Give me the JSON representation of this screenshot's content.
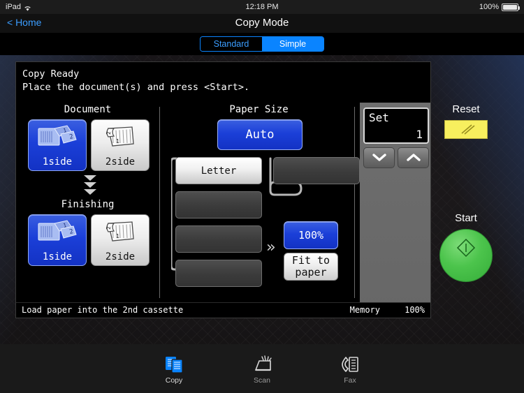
{
  "status_bar": {
    "device": "iPad",
    "wifi_icon": "wifi-icon",
    "time": "12:18 PM",
    "battery_percent": "100%",
    "battery_icon": "battery-full-icon"
  },
  "nav": {
    "back_label": "< Home",
    "title": "Copy Mode"
  },
  "mode_selector": {
    "options": [
      {
        "label": "Standard",
        "selected": false
      },
      {
        "label": "Simple",
        "selected": true
      }
    ],
    "accent_color": "#0a84ff"
  },
  "lcd": {
    "message_line1": "Copy Ready",
    "message_line2": "Place the document(s) and press <Start>.",
    "document": {
      "title": "Document",
      "buttons": [
        {
          "label": "1side",
          "selected": true,
          "icon": "sheets-1side-icon"
        },
        {
          "label": "2side",
          "selected": false,
          "icon": "sheet-2side-icon"
        }
      ]
    },
    "flow_icon": "triple-chevron-down-icon",
    "finishing": {
      "title": "Finishing",
      "buttons": [
        {
          "label": "1side",
          "selected": true,
          "icon": "sheets-1side-icon"
        },
        {
          "label": "2side",
          "selected": false,
          "icon": "sheet-2side-icon"
        }
      ]
    },
    "paper_size": {
      "title": "Paper Size",
      "auto_label": "Auto",
      "auto_selected": true,
      "trays_left": [
        {
          "label": "Letter",
          "selected": true
        },
        {
          "label": "",
          "selected": false
        },
        {
          "label": "",
          "selected": false
        },
        {
          "label": "",
          "selected": false
        }
      ],
      "trays_right": [
        {
          "label": "",
          "selected": false
        }
      ]
    },
    "zoom": {
      "arrow_icon": "double-chevron-right-icon",
      "buttons": [
        {
          "label": "100%",
          "selected": true
        },
        {
          "label": "Fit to\npaper",
          "selected": false
        }
      ]
    },
    "set": {
      "label": "Set",
      "value": "1",
      "down_icon": "chevron-down-icon",
      "up_icon": "chevron-up-icon"
    },
    "status": {
      "message": "Load paper into the 2nd cassette",
      "memory_label": "Memory",
      "memory_value": "100%"
    }
  },
  "hard_keys": {
    "reset_label": "Reset",
    "reset_icon": "reset-key-icon",
    "reset_color": "#f7ef5e",
    "start_label": "Start",
    "start_icon": "start-diamond-icon",
    "start_color": "#4cc44c"
  },
  "tab_bar": {
    "tabs": [
      {
        "label": "Copy",
        "icon": "copy-icon",
        "active": true
      },
      {
        "label": "Scan",
        "icon": "scan-icon",
        "active": false
      },
      {
        "label": "Fax",
        "icon": "fax-icon",
        "active": false
      }
    ],
    "active_color": "#0a84ff"
  }
}
